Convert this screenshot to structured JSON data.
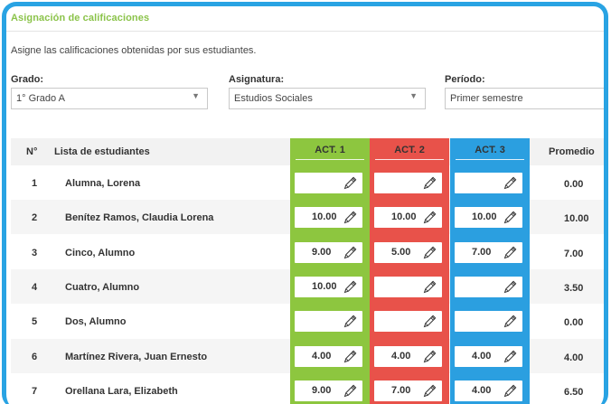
{
  "header": {
    "title": "Asignación de calificaciones",
    "subtitle": "Asigne las calificaciones obtenidas por sus estudiantes."
  },
  "filters": {
    "grado": {
      "label": "Grado:",
      "value": "1° Grado A"
    },
    "asignatura": {
      "label": "Asignatura:",
      "value": "Estudios Sociales"
    },
    "periodo": {
      "label": "Período:",
      "value": "Primer semestre"
    }
  },
  "table": {
    "headers": {
      "num": "N°",
      "students": "Lista de estudiantes",
      "act1": "ACT. 1",
      "act2": "ACT. 2",
      "act3": "ACT. 3",
      "average": "Promedio"
    },
    "rows": [
      {
        "num": "1",
        "name": "Alumna, Lorena",
        "act1": "",
        "act2": "",
        "act3": "",
        "average": "0.00"
      },
      {
        "num": "2",
        "name": "Benítez Ramos, Claudia Lorena",
        "act1": "10.00",
        "act2": "10.00",
        "act3": "10.00",
        "average": "10.00"
      },
      {
        "num": "3",
        "name": "Cinco, Alumno",
        "act1": "9.00",
        "act2": "5.00",
        "act3": "7.00",
        "average": "7.00"
      },
      {
        "num": "4",
        "name": "Cuatro, Alumno",
        "act1": "10.00",
        "act2": "",
        "act3": "",
        "average": "3.50"
      },
      {
        "num": "5",
        "name": "Dos, Alumno",
        "act1": "",
        "act2": "",
        "act3": "",
        "average": "0.00"
      },
      {
        "num": "6",
        "name": "Martínez Rivera, Juan Ernesto",
        "act1": "4.00",
        "act2": "4.00",
        "act3": "4.00",
        "average": "4.00"
      },
      {
        "num": "7",
        "name": "Orellana Lara, Elizabeth",
        "act1": "9.00",
        "act2": "7.00",
        "act3": "4.00",
        "average": "6.50"
      }
    ]
  },
  "colors": {
    "frame": "#29a3e3",
    "title": "#8bc34a",
    "act1": "#8dc63f",
    "act2": "#e8524a",
    "act3": "#2b9fe0",
    "row_alt": "#f5f5f5"
  },
  "icons": {
    "edit": "pencil-icon",
    "dropdown": "caret-down-icon"
  }
}
